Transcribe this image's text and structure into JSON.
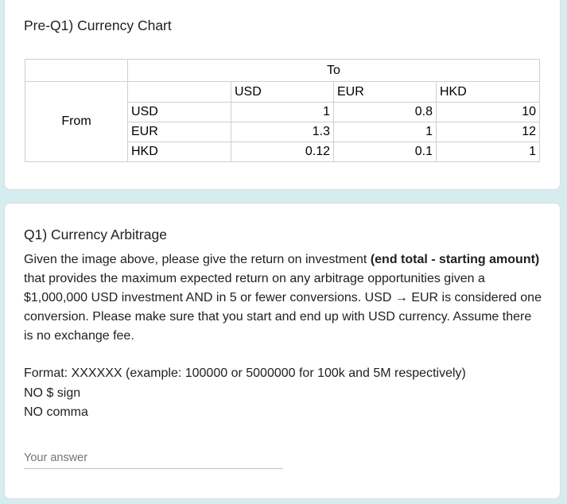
{
  "card1": {
    "title": "Pre-Q1) Currency Chart",
    "table": {
      "to_label": "To",
      "from_label": "From",
      "columns": [
        "USD",
        "EUR",
        "HKD"
      ],
      "rows": [
        {
          "currency": "USD",
          "values": [
            "1",
            "0.8",
            "10"
          ]
        },
        {
          "currency": "EUR",
          "values": [
            "1.3",
            "1",
            "12"
          ]
        },
        {
          "currency": "HKD",
          "values": [
            "0.12",
            "0.1",
            "1"
          ]
        }
      ]
    }
  },
  "card2": {
    "title": "Q1) Currency Arbitrage",
    "body_part1": "Given the image above, please give the return on investment ",
    "body_bold": "(end total - starting amount)",
    "body_part2": " that provides the maximum expected return on any arbitrage opportunities given a $1,000,000 USD investment AND in 5 or fewer conversions. USD → EUR is considered one conversion. Please make sure that you start and end up with USD currency. Assume there is no exchange fee.",
    "format_line": "Format: XXXXXX (example: 100000 or 5000000 for 100k and 5M respectively)",
    "no_sign_line": "NO $ sign",
    "no_comma_line": "NO comma",
    "answer": {
      "placeholder": "Your answer",
      "value": ""
    }
  }
}
